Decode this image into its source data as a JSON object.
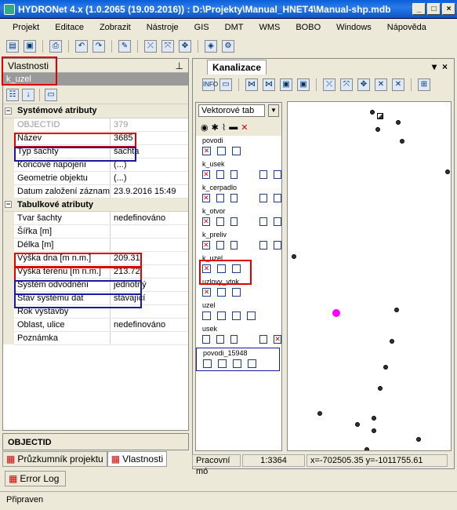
{
  "window": {
    "title": "HYDRONet 4.x (1.0.2065 (19.09.2016)) : D:\\Projekty\\Manual_HNET4\\Manual-shp.mdb",
    "min": "_",
    "max": "□",
    "close": "×"
  },
  "menu": [
    "Projekt",
    "Editace",
    "Zobrazit",
    "Nástroje",
    "GIS",
    "DMT",
    "WMS",
    "BOBO",
    "Windows",
    "Nápověda"
  ],
  "properties": {
    "header": "Vlastnosti",
    "pin": "⊥",
    "object": "k_uzel",
    "cat1": "Systémové atributy",
    "cat2": "Tabulkové atributy",
    "sys": [
      {
        "name": "OBJECTID",
        "value": "379"
      },
      {
        "name": "Název",
        "value": "3685"
      },
      {
        "name": "Typ šachty",
        "value": "šachta"
      },
      {
        "name": "Koncové napojení",
        "value": "(...)"
      },
      {
        "name": "Geometrie objektu",
        "value": "(...)"
      },
      {
        "name": "Datum založení záznam",
        "value": "23.9.2016 15:49"
      }
    ],
    "tab": [
      {
        "name": "Tvar šachty",
        "value": "nedefinováno"
      },
      {
        "name": "Šířka [m]",
        "value": ""
      },
      {
        "name": "Délka [m]",
        "value": ""
      },
      {
        "name": "Výška dna [m n.m.]",
        "value": "209.31"
      },
      {
        "name": "Výška terénu [m n.m.]",
        "value": "213.72"
      },
      {
        "name": "Systém odvodnění",
        "value": "jednotný"
      },
      {
        "name": "Stav systému dat",
        "value": "stávající"
      },
      {
        "name": "Rok výstavby",
        "value": ""
      },
      {
        "name": "Oblast, ulice",
        "value": "nedefinováno"
      },
      {
        "name": "Poznámka",
        "value": ""
      }
    ],
    "description": "OBJECTID"
  },
  "tabs": {
    "explorer": "Průzkumník projektu",
    "props": "Vlastnosti",
    "errorlog": "Error Log"
  },
  "status": "Připraven",
  "map": {
    "tab": "Kanalizace",
    "layer_select": "Vektorové tab",
    "layers": [
      {
        "name": "povodi",
        "boxes": [
          1,
          0,
          0
        ]
      },
      {
        "name": "k_usek",
        "boxes": [
          1,
          0,
          0,
          0,
          0
        ]
      },
      {
        "name": "k_cerpadlo",
        "boxes": [
          1,
          0,
          0,
          0,
          0
        ]
      },
      {
        "name": "k_otvor",
        "boxes": [
          1,
          0,
          0,
          0,
          0
        ]
      },
      {
        "name": "k_preliv",
        "boxes": [
          1,
          0,
          0,
          0,
          0
        ]
      },
      {
        "name": "k_uzel",
        "boxes": [
          1,
          0,
          0
        ]
      },
      {
        "name": "uzlovy_vtok",
        "boxes": [
          1,
          0,
          0
        ]
      },
      {
        "name": "uzel",
        "boxes": [
          0,
          0,
          0,
          0
        ]
      },
      {
        "name": "usek",
        "boxes": [
          0,
          0,
          0,
          0,
          1
        ]
      },
      {
        "name": "povodi_15948",
        "boxes": [
          0,
          0,
          0,
          0
        ]
      }
    ],
    "status_label": "Pracovní mó",
    "scale": "1:3364",
    "coords": "x=-702505.35 y=-1011755.61"
  }
}
